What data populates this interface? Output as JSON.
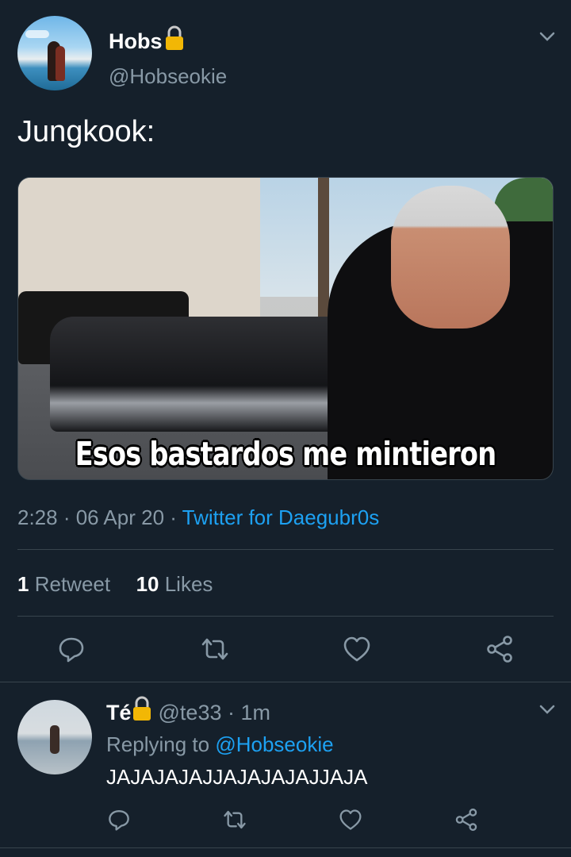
{
  "colors": {
    "background": "#15202b",
    "secondary_text": "#8899a6",
    "link": "#1da1f2",
    "divider": "#38444d",
    "lock": "#f2b705"
  },
  "main_tweet": {
    "display_name": "Hobs",
    "handle": "@Hobseokie",
    "text": "Jungkook:",
    "media_caption": "Esos bastardos me mintieron",
    "time": "2:28",
    "sep1": " · ",
    "date": "06 Apr 20",
    "sep2": " · ",
    "source": "Twitter for Daegubr0s",
    "retweets_count": "1",
    "retweets_label": "Retweet",
    "likes_count": "10",
    "likes_label": "Likes"
  },
  "reply_tweet": {
    "display_name": "Té",
    "handle_time": "@te33 · 1m",
    "replying_prefix": "Replying to ",
    "replying_mention": "@Hobseokie",
    "text": "JAJAJAJAJJAJAJAJAJJAJA"
  },
  "icons": [
    "chevron-down-icon",
    "lock-icon",
    "reply-icon",
    "retweet-icon",
    "like-icon",
    "share-icon"
  ]
}
